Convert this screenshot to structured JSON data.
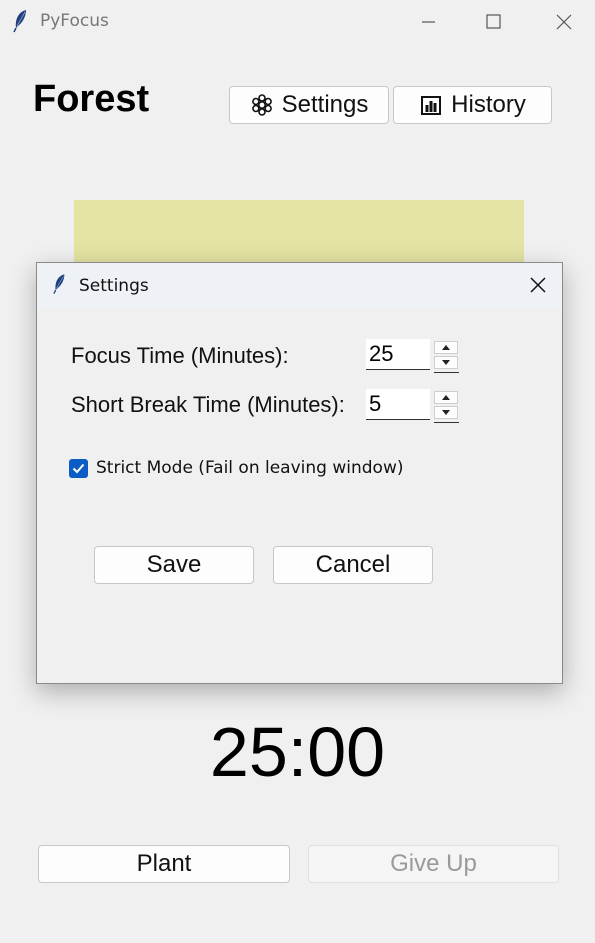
{
  "window": {
    "title": "PyFocus"
  },
  "main": {
    "heading": "Forest",
    "settings_label": "Settings",
    "history_label": "History",
    "forest_color": "#e3e3a3",
    "timer": "25:00",
    "plant_label": "Plant",
    "giveup_label": "Give Up"
  },
  "dialog": {
    "title": "Settings",
    "focus_label": "Focus Time (Minutes):",
    "focus_value": "25",
    "break_label": "Short Break Time (Minutes):",
    "break_value": "5",
    "strict_label": "Strict Mode (Fail on leaving window)",
    "strict_checked": true,
    "save_label": "Save",
    "cancel_label": "Cancel"
  },
  "icons": {
    "app": "feather-icon",
    "settings": "gear-icon",
    "history": "bar-chart-icon",
    "minimize": "minimize-icon",
    "maximize": "maximize-icon",
    "close": "close-icon"
  },
  "colors": {
    "checkbox": "#0b5cc5",
    "forest": "#e3e3a3"
  }
}
